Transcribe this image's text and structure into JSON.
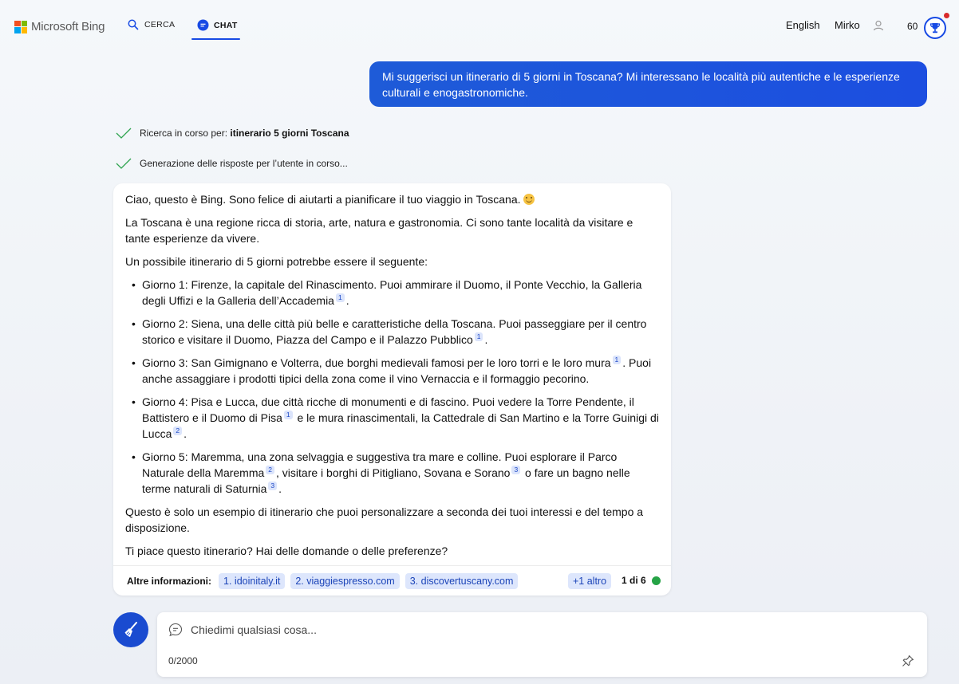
{
  "header": {
    "brand": "Microsoft Bing",
    "nav": [
      {
        "label": "CERCA",
        "icon": "search-icon"
      },
      {
        "label": "CHAT",
        "icon": "chat-icon"
      }
    ],
    "language": "English",
    "user_name": "Mirko",
    "points": "60"
  },
  "user_message": "Mi suggerisci un itinerario di 5 giorni in Toscana? Mi interessano le località più autentiche e le esperienze culturali e enogastronomiche.",
  "progress": {
    "search_prefix": "Ricerca in corso per:",
    "search_query": "itinerario 5 giorni Toscana",
    "generating": "Generazione delle risposte per l’utente in corso..."
  },
  "answer": {
    "greeting": "Ciao, questo è Bing. Sono felice di aiutarti a pianificare il tuo viaggio in Toscana.",
    "intro": "La Toscana è una regione ricca di storia, arte, natura e gastronomia. Ci sono tante località da visitare e tante esperienze da vivere.",
    "lead": "Un possibile itinerario di 5 giorni potrebbe essere il seguente:",
    "days": [
      {
        "a": "Giorno 1: Firenze, la capitale del Rinascimento. Puoi ammirare il Duomo, il Ponte Vecchio, la Galleria degli Uffizi e la Galleria dell’Accademia",
        "c1": "1",
        "b": ".",
        "c2": "",
        "c3": "",
        "d": "",
        "e": ""
      },
      {
        "a": "Giorno 2: Siena, una delle città più belle e caratteristiche della Toscana. Puoi passeggiare per il centro storico e visitare il Duomo, Piazza del Campo e il Palazzo Pubblico",
        "c1": "1",
        "b": ".",
        "c2": "",
        "c3": "",
        "d": "",
        "e": ""
      },
      {
        "a": "Giorno 3: San Gimignano e Volterra, due borghi medievali famosi per le loro torri e le loro mura",
        "c1": "1",
        "b": ". Puoi anche assaggiare i prodotti tipici della zona come il vino Vernaccia e il formaggio pecorino.",
        "c2": "",
        "c3": "",
        "d": "",
        "e": ""
      },
      {
        "a": "Giorno 4: Pisa e Lucca, due città ricche di monumenti e di fascino. Puoi vedere la Torre Pendente, il Battistero e il Duomo di Pisa",
        "c1": "1",
        "b": " e le mura rinascimentali, la Cattedrale di San Martino e la Torre Guinigi di Lucca",
        "c2": "2",
        "d": ".",
        "c3": "",
        "e": ""
      },
      {
        "a": "Giorno 5: Maremma, una zona selvaggia e suggestiva tra mare e colline. Puoi esplorare il Parco Naturale della Maremma",
        "c1": "2",
        "b": ", visitare i borghi di Pitigliano, Sovana e Sorano",
        "c2": "3",
        "d": " o fare un bagno nelle terme naturali di Saturnia",
        "c3": "3",
        "e": "."
      }
    ],
    "closing": "Questo è solo un esempio di itinerario che puoi personalizzare a seconda dei tuoi interessi e del tempo a disposizione.",
    "question": "Ti piace questo itinerario? Hai delle domande o delle preferenze?"
  },
  "learn_more": {
    "label": "Altre informazioni:",
    "sources": [
      "1. idoinitaly.it",
      "2. viaggiespresso.com",
      "3. discovertuscany.com"
    ],
    "more": "+1 altro",
    "turn": "1 di 6"
  },
  "input": {
    "placeholder": "Chiedimi qualsiasi cosa...",
    "counter": "0/2000"
  },
  "colors": {
    "accent": "#174ae4",
    "user_bubble": "#1e5bd8",
    "chip_bg": "#dde6fc",
    "turn_indicator": "#26a346",
    "notification": "#d92b2b"
  }
}
